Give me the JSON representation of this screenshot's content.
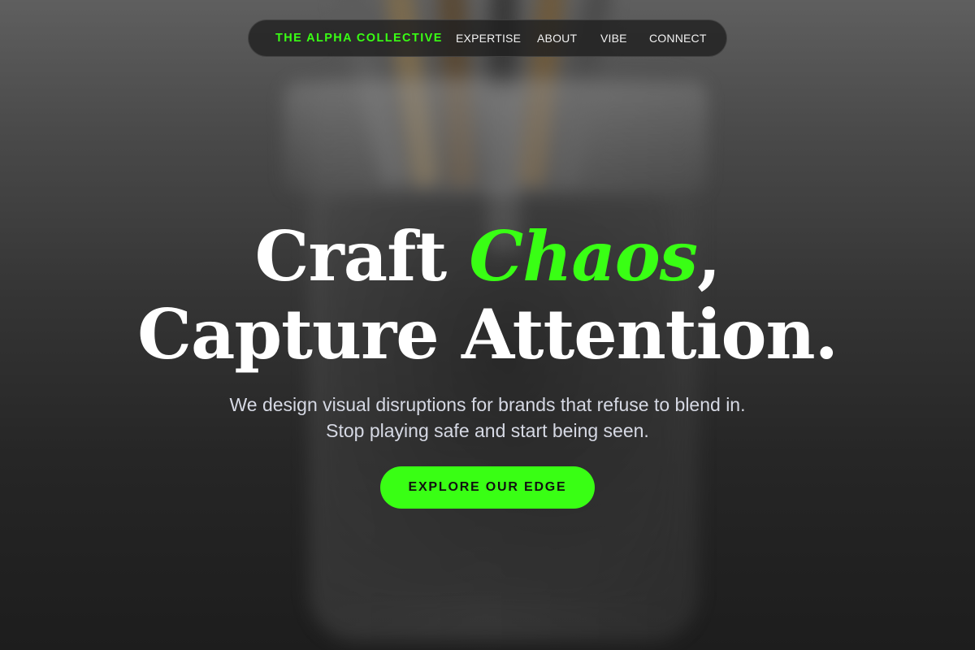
{
  "nav": {
    "brand": "THE ALPHA COLLECTIVE",
    "links": [
      {
        "label": "EXPERTISE"
      },
      {
        "label": "ABOUT"
      },
      {
        "label": "VIBE"
      },
      {
        "label": "CONNECT"
      }
    ]
  },
  "hero": {
    "headline_part1": "Craft ",
    "headline_accent": "Chaos",
    "headline_part2": ",",
    "headline_line2": "Capture Attention.",
    "subtitle": "We design visual disruptions for brands that refuse to blend in. Stop playing safe and start being seen.",
    "cta_label": "EXPLORE OUR EDGE"
  },
  "colors": {
    "accent": "#39ff14",
    "nav_background": "#1e1e1e",
    "subtitle_text": "#d6d9e4"
  }
}
